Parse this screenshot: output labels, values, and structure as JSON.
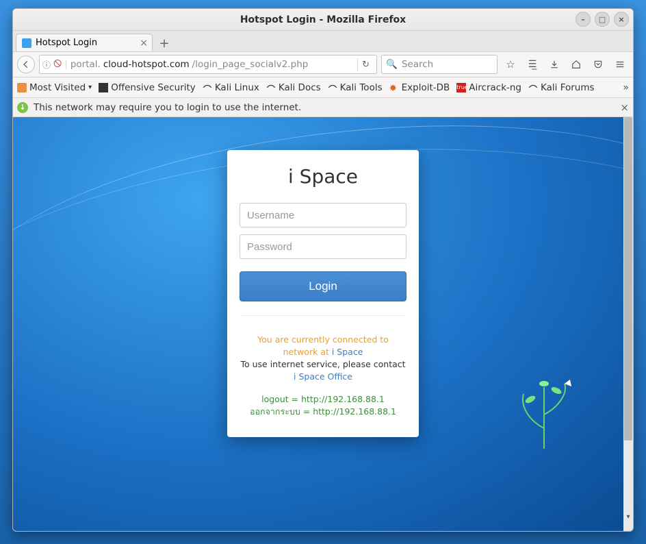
{
  "window": {
    "title": "Hotspot Login - Mozilla Firefox"
  },
  "tab": {
    "label": "Hotspot Login"
  },
  "url": {
    "prefix": "portal.",
    "domain": "cloud-hotspot.com",
    "path": "/login_page_socialv2.php"
  },
  "search": {
    "placeholder": "Search"
  },
  "bookmarks": [
    {
      "label": "Most Visited"
    },
    {
      "label": "Offensive Security"
    },
    {
      "label": "Kali Linux"
    },
    {
      "label": "Kali Docs"
    },
    {
      "label": "Kali Tools"
    },
    {
      "label": "Exploit-DB"
    },
    {
      "label": "Aircrack-ng"
    },
    {
      "label": "Kali Forums"
    }
  ],
  "infobar": {
    "text": "This network may require you to login to use the internet."
  },
  "login": {
    "title": "i Space",
    "username_placeholder": "Username",
    "password_placeholder": "Password",
    "button": "Login"
  },
  "message": {
    "line1": "You are currently connected to network at ",
    "network": "i Space",
    "line2": "To use internet service, please contact",
    "office": "i Space Office",
    "logout": "logout = http://192.168.88.1",
    "alt": "ออกจากระบบ = http://192.168.88.1"
  }
}
